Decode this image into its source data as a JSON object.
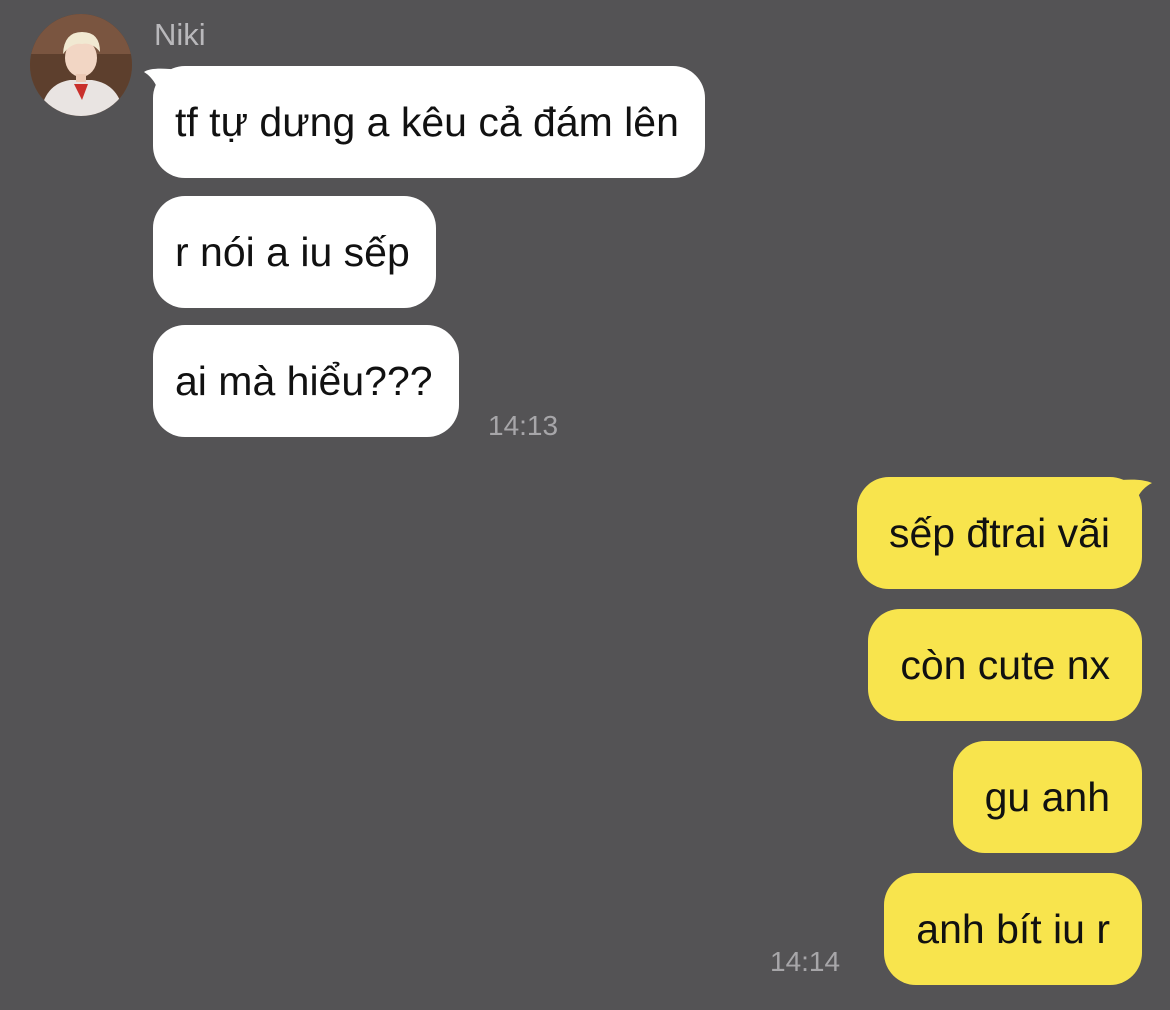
{
  "contact": {
    "name": "Niki"
  },
  "incoming": {
    "messages": [
      "tf tự dưng a kêu cả đám lên",
      "r nói a iu sếp",
      "ai mà hiểu???"
    ],
    "time": "14:13"
  },
  "outgoing": {
    "messages": [
      "sếp đtrai vãi",
      "còn cute nx",
      "gu anh",
      "anh bít iu r"
    ],
    "time": "14:14"
  },
  "colors": {
    "background": "#545355",
    "incoming_bubble": "#ffffff",
    "outgoing_bubble": "#f8e44d",
    "text": "#111111",
    "meta_text": "#a7a6a9"
  }
}
